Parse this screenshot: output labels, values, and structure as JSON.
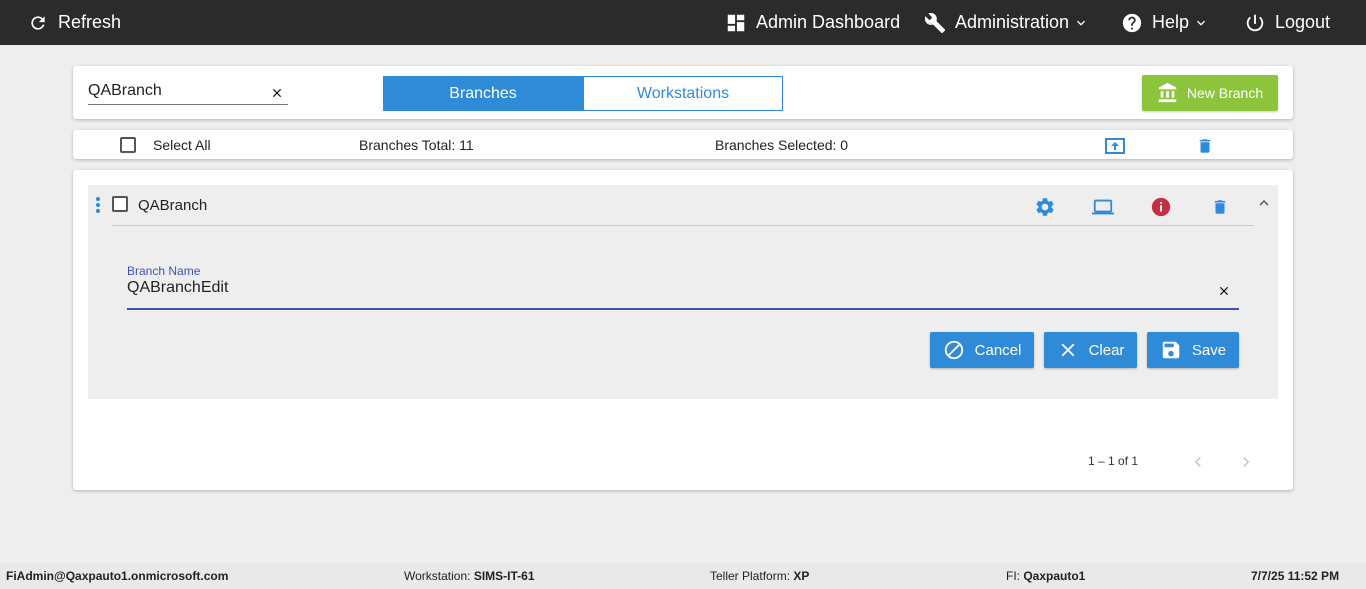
{
  "topbar": {
    "refresh_label": "Refresh",
    "dashboard_label": "Admin Dashboard",
    "administration_label": "Administration",
    "help_label": "Help",
    "logout_label": "Logout"
  },
  "search": {
    "value": "QABranch"
  },
  "tabs": [
    {
      "label": "Branches",
      "active": true
    },
    {
      "label": "Workstations",
      "active": false
    }
  ],
  "new_branch_label": "New Branch",
  "summary": {
    "select_all_label": "Select All",
    "total_label": "Branches Total: 11",
    "selected_label": "Branches Selected: 0"
  },
  "branch": {
    "name": "QABranch",
    "field_label": "Branch Name",
    "field_value": "QABranchEdit",
    "cancel_label": "Cancel",
    "clear_label": "Clear",
    "save_label": "Save"
  },
  "paginator": {
    "range_label": "1 – 1 of 1"
  },
  "footer": {
    "user": "FiAdmin@Qaxpauto1.onmicrosoft.com",
    "workstation_label": "Workstation:",
    "workstation_value": "SIMS-IT-61",
    "platform_label": "Teller Platform:",
    "platform_value": "XP",
    "fi_label": "FI:",
    "fi_value": "Qaxpauto1",
    "datetime": "7/7/25 11:52 PM"
  },
  "colors": {
    "primary": "#2f8bd8",
    "success": "#8cc43c",
    "danger": "#c62f3f",
    "topbar": "#2b2b2b",
    "field_accent": "#3f51b5"
  }
}
